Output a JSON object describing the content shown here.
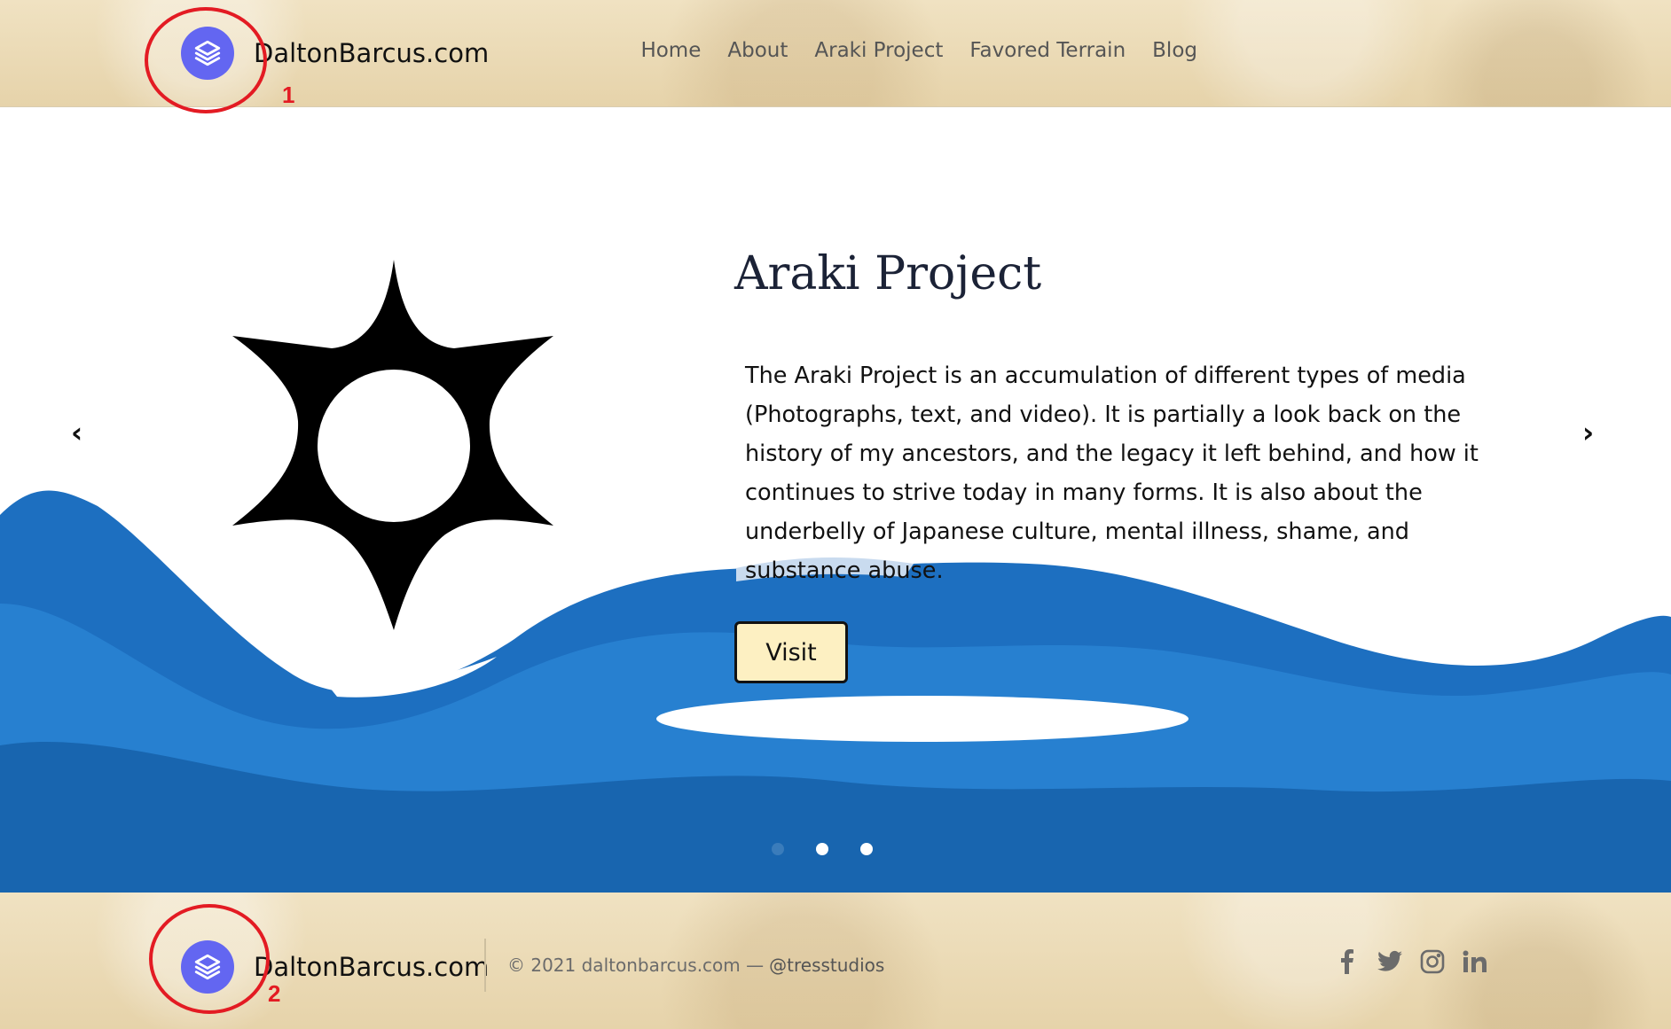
{
  "header": {
    "brand": "DaltonBarcus.com",
    "logo_icon": "layers-icon",
    "nav": [
      "Home",
      "About",
      "Araki Project",
      "Favored Terrain",
      "Blog"
    ]
  },
  "annotations": [
    "1",
    "2"
  ],
  "hero": {
    "title": "Araki Project",
    "description": "The Araki Project is an accumulation of different types of media (Photographs, text, and video). It is partially a look back on the history of my ancestors, and the legacy it left behind, and how it continues to strive today in many forms. It is also about the underbelly of Japanese culture, mental illness, shame, and substance abuse.",
    "button": "Visit",
    "prev_arrow": "‹",
    "next_arrow": "›",
    "emblem_icon": "six-point-star-icon",
    "slides": 3,
    "active_slide": 1
  },
  "footer": {
    "brand": "DaltonBarcus.com",
    "copyright": "© 2021 daltonbarcus.com —",
    "handle": "@tresstudios",
    "social": [
      "facebook-icon",
      "twitter-icon",
      "instagram-icon",
      "linkedin-icon"
    ]
  },
  "colors": {
    "logo": "#6366f1",
    "wave": "#1d6fc0",
    "button_bg": "#fdf0c2",
    "annotation": "#e31b23"
  }
}
